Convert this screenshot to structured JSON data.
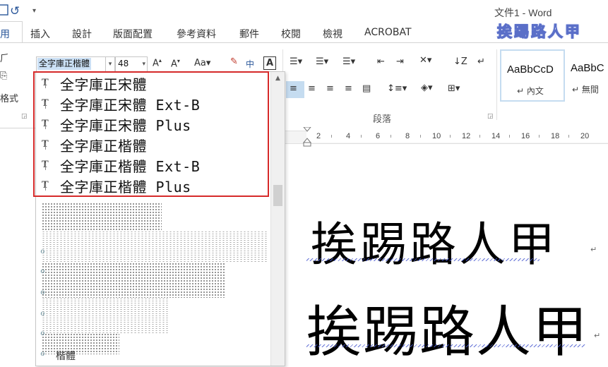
{
  "window": {
    "title": "文件1 - Word",
    "brand_text": "挨踢路人甲"
  },
  "tabs": [
    {
      "label": "用",
      "active": true
    },
    {
      "label": "插入"
    },
    {
      "label": "設計"
    },
    {
      "label": "版面配置"
    },
    {
      "label": "參考資料"
    },
    {
      "label": "郵件"
    },
    {
      "label": "校閱"
    },
    {
      "label": "檢視"
    },
    {
      "label": "ACROBAT"
    }
  ],
  "ribbon": {
    "left_partial_label": "格式",
    "font_name": "全字庫正楷體",
    "font_size": "48",
    "paragraph_group": "段落",
    "styles": [
      {
        "sample": "AaBbCcD",
        "name": "內文"
      },
      {
        "sample": "AaBbC",
        "name": "無間"
      }
    ]
  },
  "ruler": {
    "numbers": [
      "2",
      "4",
      "6",
      "8",
      "10",
      "12",
      "14",
      "16",
      "18",
      "20"
    ]
  },
  "document": {
    "lines": [
      "挨踢路人甲",
      "挨踢路人甲"
    ]
  },
  "font_dropdown": {
    "items": [
      "全字庫正宋體",
      "全字庫正宋體 Ext-B",
      "全字庫正宋體 Plus",
      "全字庫正楷體",
      "全字庫正楷體 Ext-B",
      "全字庫正楷體 Plus"
    ],
    "partial_bottom_item": "楷體"
  },
  "colors": {
    "accent": "#2b579a",
    "highlight_border": "#d62a2a",
    "selection": "#cbe0f5"
  }
}
